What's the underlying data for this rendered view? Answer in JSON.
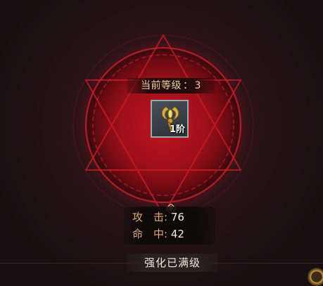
{
  "upgrade_panel": {
    "level_label": "当前等级",
    "level_separator": "：",
    "level_value": "3",
    "item_tier": "1阶",
    "item_icon": "golden-scepter-icon",
    "stats": [
      {
        "label": "攻　击",
        "value": "76"
      },
      {
        "label": "命　中",
        "value": "42"
      }
    ],
    "action_button": "强化已满级"
  },
  "colors": {
    "circle_red": "#b3141e",
    "label_gold": "#e0a874",
    "level_text": "#e8cfa0"
  }
}
